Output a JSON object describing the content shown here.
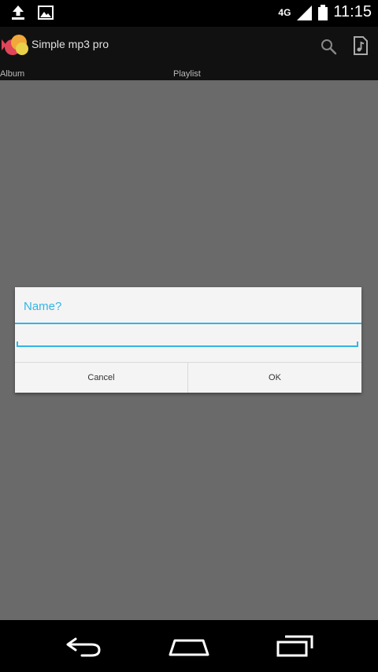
{
  "status_bar": {
    "time": "11:15",
    "network_label": "4G",
    "left_icons": [
      "upload-icon",
      "image-icon"
    ],
    "right_icons": [
      "signal-icon",
      "battery-icon"
    ]
  },
  "app_bar": {
    "title": "Simple mp3 pro",
    "actions": [
      "search-icon",
      "file-music-icon"
    ]
  },
  "tabs": [
    {
      "label": "Album"
    },
    {
      "label": "Playlist"
    }
  ],
  "dialog": {
    "title": "Name?",
    "input_value": "",
    "cancel_label": "Cancel",
    "ok_label": "OK"
  },
  "colors": {
    "accent": "#33b5e5",
    "scrim": "#6a6a6a",
    "dialog_bg": "#f4f4f4"
  }
}
